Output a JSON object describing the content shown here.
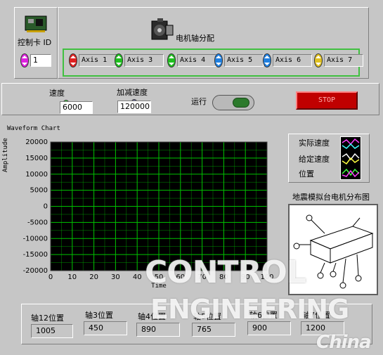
{
  "card_id": {
    "label": "控制卡 ID",
    "value": "1"
  },
  "motor_assign": {
    "label": "电机轴分配"
  },
  "axes": [
    "Axis 1",
    "Axis 3",
    "Axis 4",
    "Axis 5",
    "Axis 6",
    "Axis 7"
  ],
  "speed": {
    "label": "速度",
    "value": "6000"
  },
  "accel": {
    "label": "加减速度",
    "value": "120000"
  },
  "run": {
    "label": "运行"
  },
  "stop": {
    "label": "STOP"
  },
  "chart_data": {
    "type": "line",
    "title": "Waveform Chart",
    "xlabel": "Time",
    "ylabel": "Amplitude",
    "xlim": [
      0,
      100
    ],
    "ylim": [
      -20000,
      20000
    ],
    "x_ticks": [
      0,
      10,
      20,
      30,
      40,
      50,
      60,
      70,
      80,
      90,
      100
    ],
    "y_ticks": [
      20000,
      15000,
      10000,
      5000,
      0,
      -5000,
      -10000,
      -15000,
      -20000
    ],
    "grid": true,
    "series": []
  },
  "legend": {
    "items": [
      "实际速度",
      "给定速度",
      "位置"
    ]
  },
  "map": {
    "title": "地震模拟台电机分布图"
  },
  "positions": [
    {
      "label": "轴12位置",
      "value": "1005"
    },
    {
      "label": "轴3位置",
      "value": "450"
    },
    {
      "label": "轴4位置",
      "value": "890"
    },
    {
      "label": "轴5位置",
      "value": "765"
    },
    {
      "label": "轴6位置",
      "value": "900"
    },
    {
      "label": "轴7位置",
      "value": "1200"
    }
  ],
  "watermark": {
    "line1": "CONTROL",
    "line2": "ENGINEERING",
    "line3": "China"
  },
  "colors": {
    "chart_bg": "#000000",
    "grid": "#00c000",
    "panel": "#c6c6c6",
    "axis_group_border": "#40c040"
  }
}
